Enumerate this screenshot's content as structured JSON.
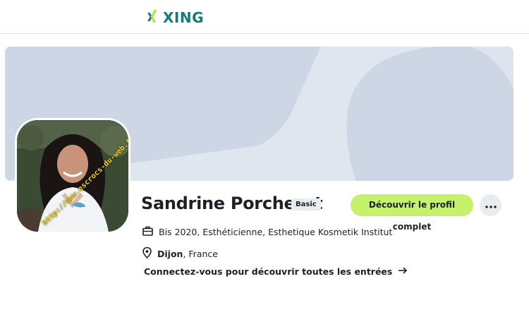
{
  "header": {
    "logo_text": "XING",
    "logo_icon": "xing-x-icon",
    "brand_colors": {
      "primary": "#0f7d7e",
      "accent": "#c6f16d"
    }
  },
  "profile": {
    "name": "Sandrine Porcheret",
    "membership_badge": "Basic",
    "cta_label": "Découvrir le profil complet",
    "more_icon": "more-dots-icon",
    "avatar_watermark": "http://www.escrocs-du-web.fr",
    "job_icon": "briefcase-icon",
    "job_text": "Bis 2020, Esthéticienne, Esthetique Kosmetik Institut",
    "location_icon": "location-pin-icon",
    "location_city": "Dijon",
    "location_country": ", France",
    "connect_link": "Connectez-vous pour découvrir toutes les entrées",
    "connect_arrow_icon": "arrow-right-icon"
  }
}
